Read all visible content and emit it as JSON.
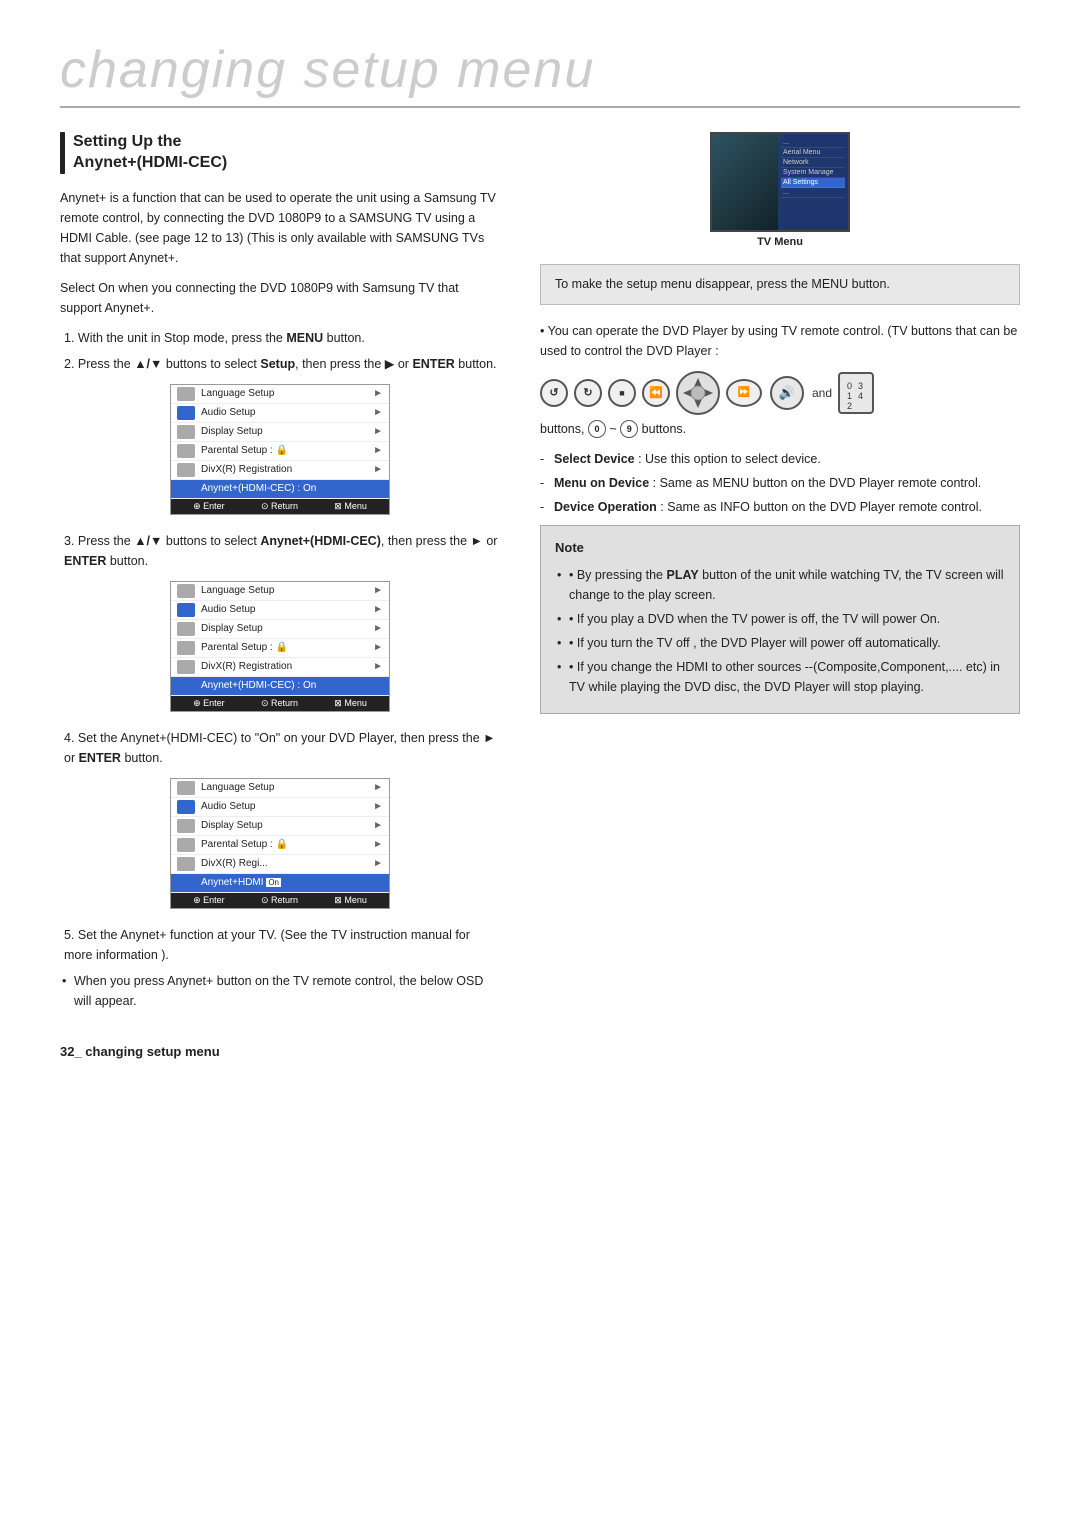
{
  "page": {
    "title": "changing setup menu",
    "footer": "32_ changing setup menu"
  },
  "section": {
    "heading_line1": "Setting Up the",
    "heading_line2": "Anynet+(HDMI-CEC)"
  },
  "left_col": {
    "intro_para": "Anynet+ is a function that can be used to operate the unit using a Samsung TV  remote control, by connecting the DVD 1080P9 to a SAMSUNG TV using a HDMI Cable. (see page 12 to 13) (This is only available with SAMSUNG TVs that support Anynet+.",
    "select_para": "Select On when you connecting the DVD 1080P9 with Samsung TV that support Anynet+.",
    "step1": "1. With the unit in Stop mode, press the ",
    "step1_bold": "MENU",
    "step1_end": " button.",
    "step2_start": "2. Press the ",
    "step2_symbol": "▲/▼",
    "step2_mid": " buttons to select ",
    "step2_setup": "Setup",
    "step2_mid2": ", then press the ▶ or ",
    "step2_enter": "ENTER",
    "step2_end": " button.",
    "menu1": {
      "rows": [
        {
          "icon": "gray",
          "label": "Language Setup",
          "arrow": "►",
          "selected": false
        },
        {
          "icon": "blue",
          "label": "Audio Setup",
          "arrow": "►",
          "selected": false
        },
        {
          "icon": "gray",
          "label": "Display Setup",
          "arrow": "►",
          "selected": false
        },
        {
          "icon": "gray",
          "label": "Parental Setup :",
          "extra": "🔒",
          "arrow": "►",
          "selected": false
        },
        {
          "icon": "gray",
          "label": "DivX(R) Registration",
          "arrow": "►",
          "selected": false
        },
        {
          "icon": "blue",
          "label": "Anynet+(HDMI-CEC) : On",
          "arrow": "",
          "selected": true
        }
      ],
      "footer": [
        "⊕ Enter",
        "⊙ Return",
        "⊠ Menu"
      ]
    },
    "step3_start": "3. Press the ",
    "step3_symbol": "▲/▼",
    "step3_mid": " buttons to select ",
    "step3_bold": "Anynet+(HDMI-CEC)",
    "step3_mid2": ", then press the ► or ",
    "step3_enter": "ENTER",
    "step3_end": " button.",
    "menu2": {
      "rows": [
        {
          "icon": "gray",
          "label": "Language Setup",
          "arrow": "►",
          "selected": false
        },
        {
          "icon": "blue",
          "label": "Audio Setup",
          "arrow": "►",
          "selected": false
        },
        {
          "icon": "gray",
          "label": "Display Setup",
          "arrow": "►",
          "selected": false
        },
        {
          "icon": "gray",
          "label": "Parental Setup :",
          "extra": "🔒",
          "arrow": "►",
          "selected": false
        },
        {
          "icon": "gray",
          "label": "DivX(R) Registration",
          "arrow": "►",
          "selected": false
        },
        {
          "icon": "blue",
          "label": "Anynet+(HDMI-CEC) : On",
          "arrow": "",
          "selected": true
        }
      ],
      "footer": [
        "⊕ Enter",
        "⊙ Return",
        "⊠ Menu"
      ]
    },
    "step4_start": "4. Set the Anynet+(HDMI-CEC) to \"On\" on your DVD Player, then press the ► or ",
    "step4_enter": "ENTER",
    "step4_end": " button.",
    "menu3": {
      "rows": [
        {
          "icon": "gray",
          "label": "Language Setup",
          "arrow": "►",
          "selected": false
        },
        {
          "icon": "blue",
          "label": "Audio Setup",
          "arrow": "►",
          "selected": false
        },
        {
          "icon": "gray",
          "label": "Display Setup",
          "arrow": "►",
          "selected": false
        },
        {
          "icon": "gray",
          "label": "Parental Setup :",
          "extra": "🔒",
          "arrow": "►",
          "selected": false
        },
        {
          "icon": "gray",
          "label": "DivX(R) Regi...",
          "arrow": "►",
          "selected": false
        },
        {
          "icon": "blue",
          "label": "Anynet+HDMI",
          "extra": "On",
          "arrow": "",
          "selected": true
        }
      ],
      "footer": [
        "⊕ Enter",
        "⊙ Return",
        "⊠ Menu"
      ]
    },
    "step5": "5. Set the Anynet+ function at your TV. (See the TV instruction manual for more information ).",
    "step5_bullet1": "When you press Anynet+ button on the TV remote control, the below OSD will appear."
  },
  "right_col": {
    "tv_menu_label": "TV Menu",
    "tv_menu_items": [
      "...",
      "Aerial Menu",
      "Network",
      "System Manage",
      "...",
      "All Settings"
    ],
    "highlight_box": "To make the setup menu disappear, press the MENU button.",
    "operate_text": "• You can operate the DVD Player by using TV remote control. (TV buttons that can be used to control the DVD Player :",
    "and_label": "and",
    "buttons_text_start": "buttons, ",
    "buttons_text_range": "0 ~ 9",
    "buttons_text_end": " buttons.",
    "bullet_items": [
      {
        "bold_part": "Select Device",
        "rest": " : Use this option to select device."
      },
      {
        "bold_part": "Menu on Device",
        "rest": " : Same as MENU button on the DVD Player remote control."
      },
      {
        "bold_part": "Device Operation",
        "rest": " : Same as INFO button on the DVD Player remote control."
      }
    ],
    "note": {
      "title": "Note",
      "items": [
        {
          "bold_part": "PLAY",
          "text": "By pressing the PLAY button of the unit while watching TV, the TV screen will change to the play screen."
        },
        {
          "text": "If you play a DVD when the TV power is off, the TV will power On."
        },
        {
          "text": "If you turn the TV off , the DVD Player will power off automatically."
        },
        {
          "text": "If you change the HDMI to other sources --(Composite,Component,.... etc) in TV while playing the DVD disc, the DVD Player will stop playing."
        }
      ]
    }
  }
}
